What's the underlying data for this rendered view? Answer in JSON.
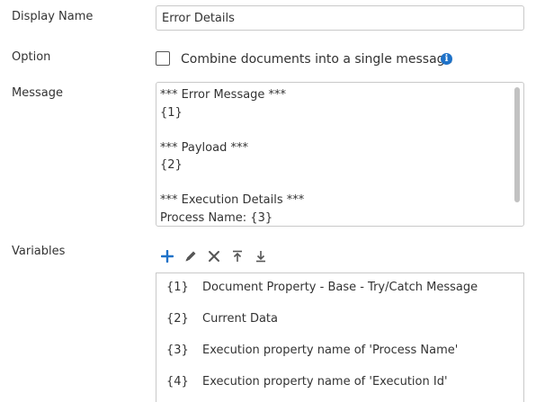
{
  "form": {
    "display_name": {
      "label": "Display Name",
      "value": "Error Details"
    },
    "option": {
      "label": "Option",
      "checkbox_label": "Combine documents into a single message",
      "checked": false,
      "info_glyph": "i"
    },
    "message": {
      "label": "Message",
      "lines": [
        "*** Error Message ***",
        "{1}",
        "",
        "*** Payload ***",
        "{2}",
        "",
        "*** Execution Details ***",
        "Process Name: {3}"
      ]
    },
    "variables": {
      "label": "Variables",
      "toolbar": [
        "plus-icon",
        "pencil-icon",
        "close-icon",
        "move-top-icon",
        "move-bottom-icon"
      ],
      "rows": [
        {
          "key": "{1}",
          "value": "Document Property - Base - Try/Catch Message"
        },
        {
          "key": "{2}",
          "value": "Current Data"
        },
        {
          "key": "{3}",
          "value": "Execution property name of 'Process Name'"
        },
        {
          "key": "{4}",
          "value": "Execution property name of 'Execution Id'"
        }
      ]
    }
  },
  "colors": {
    "accent": "#1f72c8",
    "border": "#c9c9c9",
    "text": "#333333",
    "icon": "#555555"
  }
}
